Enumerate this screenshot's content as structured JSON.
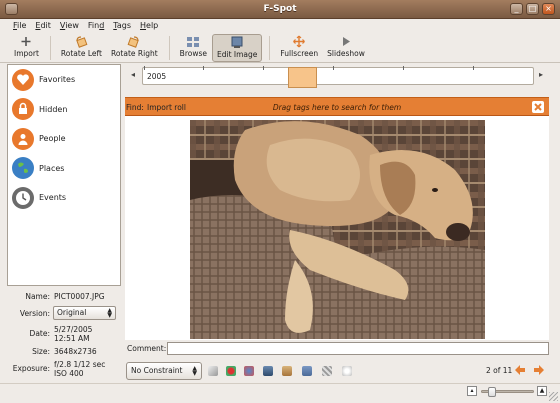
{
  "window": {
    "title": "F-Spot"
  },
  "menu": [
    {
      "label": "File",
      "u": "F",
      "rest": "ile"
    },
    {
      "label": "Edit",
      "u": "E",
      "rest": "dit"
    },
    {
      "label": "View",
      "u": "V",
      "rest": "iew"
    },
    {
      "label": "Find",
      "u": "",
      "rest": "Fin",
      "trail": "d"
    },
    {
      "label": "Tags",
      "u": "T",
      "rest": "ags"
    },
    {
      "label": "Help",
      "u": "H",
      "rest": "elp"
    }
  ],
  "toolbar": {
    "import": "Import",
    "rotate_left": "Rotate Left",
    "rotate_right": "Rotate Right",
    "browse": "Browse",
    "edit_image": "Edit Image",
    "fullscreen": "Fullscreen",
    "slideshow": "Slideshow"
  },
  "tags": [
    {
      "label": "Favorites",
      "icon": "heart-icon",
      "color": "#e8782c"
    },
    {
      "label": "Hidden",
      "icon": "lock-icon",
      "color": "#e8782c"
    },
    {
      "label": "People",
      "icon": "person-icon",
      "color": "#e8782c"
    },
    {
      "label": "Places",
      "icon": "globe-icon",
      "color": "#3a7fc4"
    },
    {
      "label": "Events",
      "icon": "clock-icon",
      "color": "#6b6b6b"
    }
  ],
  "info": {
    "name_key": "Name:",
    "name_val": "PICT0007.JPG",
    "version_key": "Version:",
    "version_val": "Original",
    "date_key": "Date:",
    "date_val1": "5/27/2005",
    "date_val2": "12:51 AM",
    "size_key": "Size:",
    "size_val": "3648x2736",
    "exposure_key": "Exposure:",
    "exposure_val1": "f/2.8 1/12 sec",
    "exposure_val2": "ISO 400"
  },
  "timeline": {
    "year": "2005"
  },
  "findbar": {
    "find": "Find:",
    "import": "Import roll",
    "hint": "Drag tags here to search for them"
  },
  "comment": {
    "label": "Comment:",
    "value": ""
  },
  "bottom": {
    "constraint": "No Constraint",
    "position": "2 of 11"
  },
  "colors": {
    "accent": "#e57f34",
    "titlebar": "#8d6a50"
  }
}
